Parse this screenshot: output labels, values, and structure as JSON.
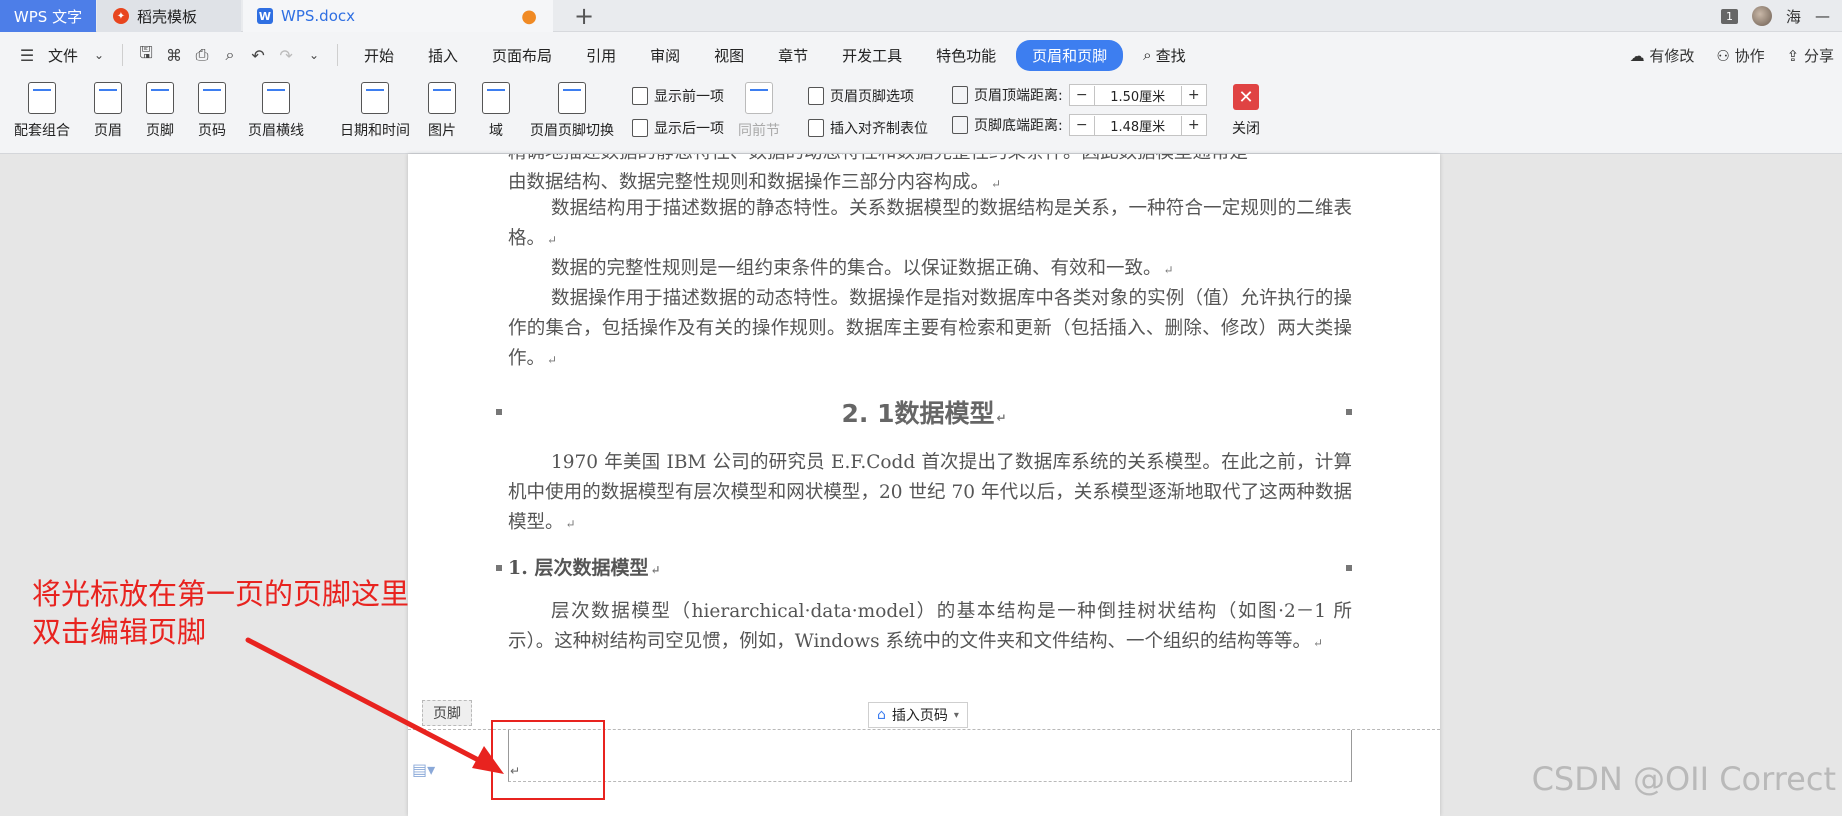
{
  "titlebar": {
    "tabs": [
      {
        "label": "WPS 文字"
      },
      {
        "label": "稻壳模板"
      },
      {
        "label": "WPS.docx"
      }
    ],
    "add_tab": "+",
    "window_badge": "1",
    "user_name": "海",
    "minimize": "—"
  },
  "menubar": {
    "file_label": "文件",
    "items": [
      "开始",
      "插入",
      "页面布局",
      "引用",
      "审阅",
      "视图",
      "章节",
      "开发工具",
      "特色功能",
      "页眉和页脚"
    ],
    "search_label": "查找",
    "right": [
      "有修改",
      "协作",
      "分享"
    ]
  },
  "ribbon": {
    "buttons": [
      "配套组合",
      "页眉",
      "页脚",
      "页码",
      "页眉横线",
      "日期和时间",
      "图片",
      "域",
      "页眉页脚切换"
    ],
    "show_prev": "显示前一项",
    "show_next": "显示后一项",
    "same_as_prev": "同前节",
    "hf_options": "页眉页脚选项",
    "insert_tab": "插入对齐制表位",
    "header_top_label": "页眉顶端距离:",
    "header_top_value": "1.50厘米",
    "footer_bottom_label": "页脚底端距离:",
    "footer_bottom_value": "1.48厘米",
    "close_label": "关闭"
  },
  "document": {
    "p0_line1": "精确地描述数据的静态特性、数据的动态特性和数据完整性约束条件。因此数据模型通常是",
    "p0_line2": "由数据结构、数据完整性规则和数据操作三部分内容构成。",
    "p1": "数据结构用于描述数据的静态特性。关系数据模型的数据结构是关系，一种符合一定规则的二维表格。",
    "p2": "数据的完整性规则是一组约束条件的集合。以保证数据正确、有效和一致。",
    "p3": "数据操作用于描述数据的动态特性。数据操作是指对数据库中各类对象的实例（值）允许执行的操作的集合，包括操作及有关的操作规则。数据库主要有检索和更新（包括插入、删除、修改）两大类操作。",
    "heading": "2. 1数据模型",
    "p4": "1970 年美国 IBM 公司的研究员 E.F.Codd 首次提出了数据库系统的关系模型。在此之前，计算机中使用的数据模型有层次模型和网状模型，20 世纪 70 年代以后，关系模型逐渐地取代了这两种数据模型。",
    "subheading": "1. 层次数据模型",
    "p5": "层次数据模型（hierarchical·data·model）的基本结构是一种倒挂树状结构（如图·2－1 所示）。这种树结构司空见惯，例如，Windows 系统中的文件夹和文件结构、一个组织的结构等等。",
    "footer_tag": "页脚",
    "insert_page_number": "插入页码",
    "return_mark": "↵"
  },
  "annotation": {
    "line1": "将光标放在第一页的页脚这里",
    "line2": "双击编辑页脚",
    "color": "#e8231f"
  },
  "watermark": "CSDN @OII Correct"
}
